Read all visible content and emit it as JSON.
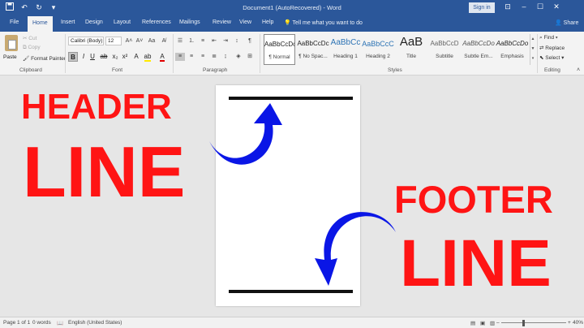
{
  "titlebar": {
    "title": "Document1 (AutoRecovered) - Word",
    "signin": "Sign in"
  },
  "tabs": [
    "File",
    "Home",
    "Insert",
    "Design",
    "Layout",
    "References",
    "Mailings",
    "Review",
    "View",
    "Help"
  ],
  "tellme": "Tell me what you want to do",
  "share": "Share",
  "clipboard": {
    "paste": "Paste",
    "cut": "Cut",
    "copy": "Copy",
    "format_painter": "Format Painter",
    "group": "Clipboard"
  },
  "font": {
    "family": "Calibri (Body)",
    "size": "12",
    "group": "Font"
  },
  "paragraph": {
    "group": "Paragraph"
  },
  "styles": {
    "group": "Styles",
    "items": [
      {
        "sample": "AaBbCcDc",
        "name": "¶ Normal"
      },
      {
        "sample": "AaBbCcDc",
        "name": "¶ No Spac..."
      },
      {
        "sample": "AaBbCc",
        "name": "Heading 1"
      },
      {
        "sample": "AaBbCcC",
        "name": "Heading 2"
      },
      {
        "sample": "AaB",
        "name": "Title"
      },
      {
        "sample": "AaBbCcD",
        "name": "Subtitle"
      },
      {
        "sample": "AaBbCcDo",
        "name": "Subtle Em..."
      },
      {
        "sample": "AaBbCcDo",
        "name": "Emphasis"
      }
    ]
  },
  "editing": {
    "find": "Find",
    "replace": "Replace",
    "select": "Select",
    "group": "Editing"
  },
  "overlay": {
    "header_1": "HEADER",
    "header_2": "LINE",
    "footer_1": "FOOTER",
    "footer_2": "LINE"
  },
  "status": {
    "page": "Page 1 of 1",
    "words": "0 words",
    "language": "English (United States)",
    "zoom": "40%"
  },
  "colors": {
    "ribbon_blue": "#2b579a",
    "overlay_red": "#ff1414",
    "arrow_blue": "#0a16e6"
  }
}
